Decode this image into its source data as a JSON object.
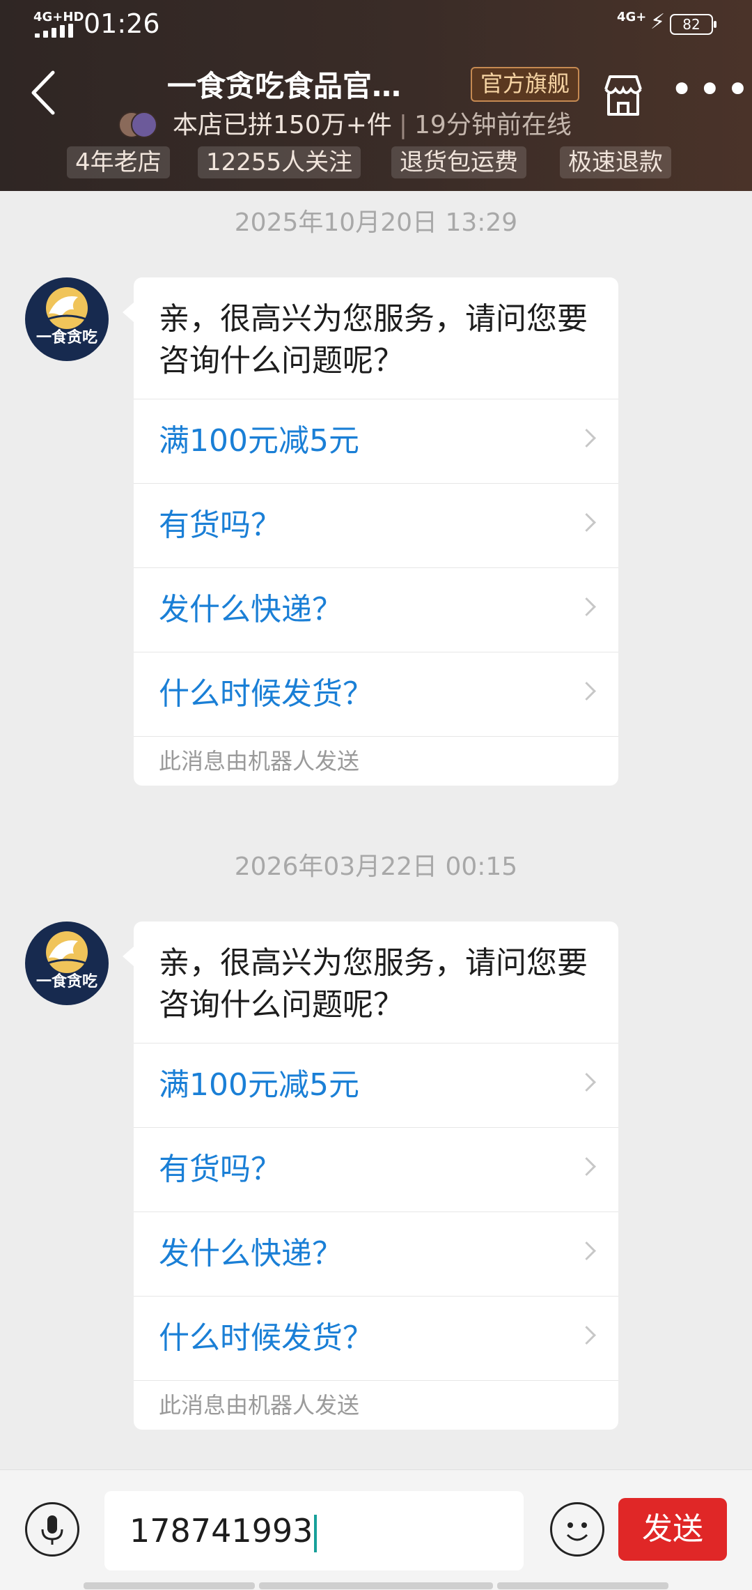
{
  "status_bar": {
    "network_left": "4G+HD",
    "time": "01:26",
    "network_right": "4G+",
    "battery": "82"
  },
  "header": {
    "shop_name": "一食贪吃食品官…",
    "official_badge": "官方旗舰",
    "group_buy_text": "本店已拼150万+件",
    "online_text": "19分钟前在线",
    "tags": [
      "4年老店",
      "12255人关注",
      "退货包运费",
      "极速退款"
    ]
  },
  "shop_logo_text": "一食贪吃",
  "conversations": [
    {
      "timestamp": "2025年10月20日 13:29",
      "greeting": "亲，很高兴为您服务，请问您要咨询什么问题呢？",
      "questions": [
        "满100元减5元",
        "有货吗？",
        "发什么快递？",
        "什么时候发货？"
      ],
      "robot_note": "此消息由机器人发送"
    },
    {
      "timestamp": "2026年03月22日 00:15",
      "greeting": "亲，很高兴为您服务，请问您要咨询什么问题呢？",
      "questions": [
        "满100元减5元",
        "有货吗？",
        "发什么快递？",
        "什么时候发货？"
      ],
      "robot_note": "此消息由机器人发送"
    }
  ],
  "input_bar": {
    "value": "178741993",
    "send_label": "发送"
  },
  "colors": {
    "header_bg": "#3a2c27",
    "link_blue": "#1a7fd6",
    "send_red": "#e02727",
    "badge_bg": "#5a3820",
    "logo_navy": "#172a4f"
  }
}
